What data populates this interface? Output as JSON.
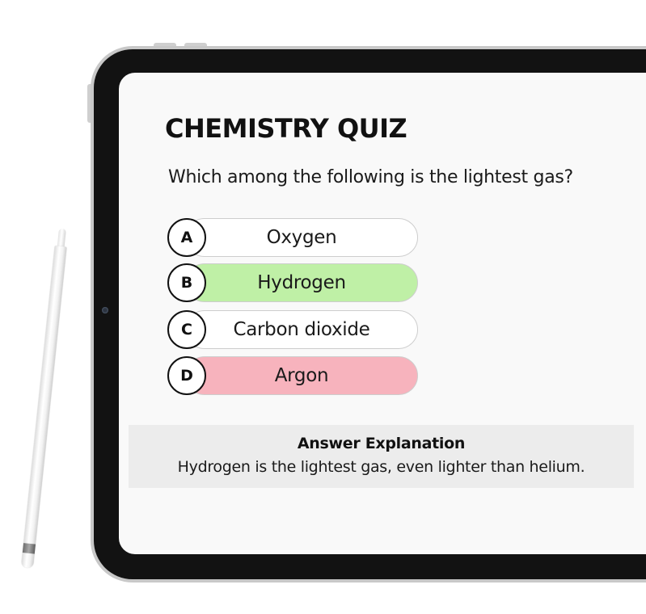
{
  "quiz": {
    "title": "CHEMISTRY QUIZ",
    "question": "Which among the following is the lightest gas?",
    "options": [
      {
        "letter": "A",
        "text": "Oxygen",
        "state": "neutral",
        "fill": "#ffffff"
      },
      {
        "letter": "B",
        "text": "Hydrogen",
        "state": "correct",
        "fill": "#bff0a6"
      },
      {
        "letter": "C",
        "text": "Carbon dioxide",
        "state": "neutral",
        "fill": "#ffffff"
      },
      {
        "letter": "D",
        "text": "Argon",
        "state": "incorrect",
        "fill": "#f7b3bd"
      }
    ],
    "explanation": {
      "heading": "Answer Explanation",
      "text": "Hydrogen is the lightest gas, even lighter than helium."
    }
  },
  "colors": {
    "correct": "#bff0a6",
    "incorrect": "#f7b3bd",
    "screen_background": "#f9f9f9",
    "explanation_background": "#ececec"
  }
}
